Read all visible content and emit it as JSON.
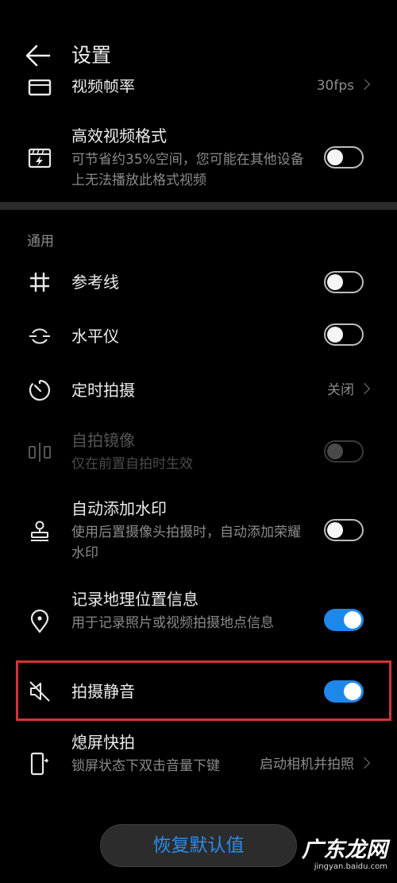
{
  "header": {
    "title": "设置"
  },
  "partial_row": {
    "title": "视频帧率",
    "value": "30fps"
  },
  "rows_video": [
    {
      "title": "高效视频格式",
      "subtitle": "可节省约35%空间，您可能在其他设备上无法播放此格式视频",
      "toggle": "off",
      "icon": "hevc-film-icon"
    }
  ],
  "section_general": {
    "label": "通用"
  },
  "rows_general": [
    {
      "title": "参考线",
      "toggle": "off",
      "icon": "grid-icon"
    },
    {
      "title": "水平仪",
      "toggle": "off",
      "icon": "level-icon"
    },
    {
      "title": "定时拍摄",
      "value": "关闭",
      "icon": "timer-icon"
    },
    {
      "title": "自拍镜像",
      "subtitle": "仅在前置自拍时生效",
      "toggle": "disabled",
      "icon": "mirror-icon"
    },
    {
      "title": "自动添加水印",
      "subtitle": "使用后置摄像头拍摄时，自动添加荣耀水印",
      "toggle": "off",
      "icon": "stamp-icon"
    },
    {
      "title": "记录地理位置信息",
      "subtitle": "用于记录照片或视频拍摄地点信息",
      "toggle": "on",
      "icon": "location-pin-icon"
    },
    {
      "title": "拍摄静音",
      "toggle": "on",
      "icon": "mute-icon"
    },
    {
      "title": "熄屏快拍",
      "subtitle": "锁屏状态下双击音量下键",
      "value": "启动相机并拍照",
      "icon": "phone-snap-icon"
    }
  ],
  "restore_button": {
    "label": "恢复默认值"
  },
  "watermark": {
    "main": "广东龙网",
    "sub": "jingyan.baidu.com"
  },
  "colors": {
    "background": "#000000",
    "accent_blue": "#1f86ea",
    "highlight_red": "#d6323a",
    "divider": "#2b2b2b"
  }
}
